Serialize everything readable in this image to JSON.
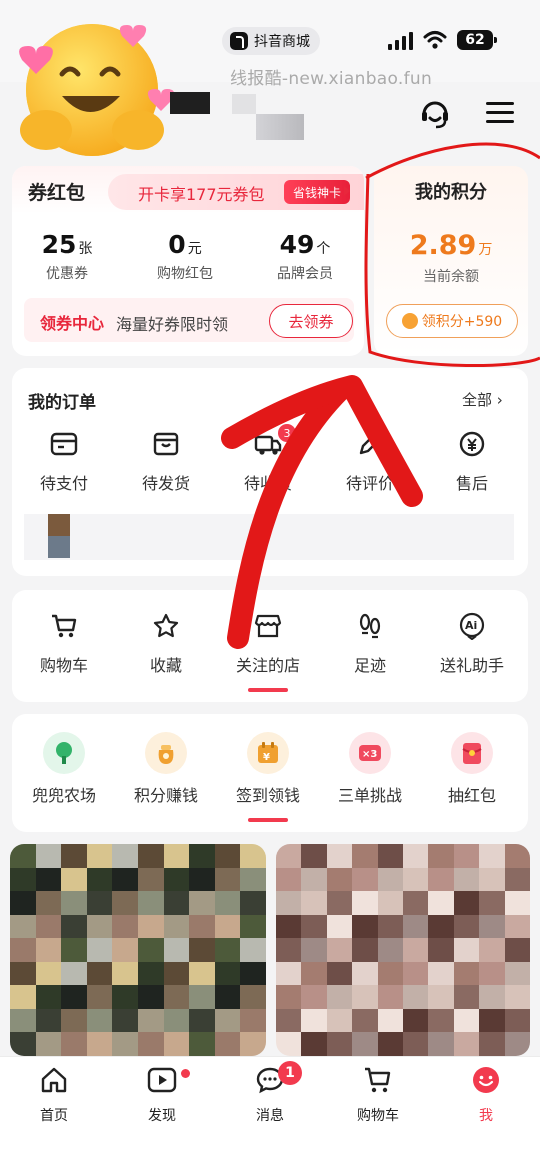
{
  "status_bar": {
    "store_name": "抖音商城",
    "battery": "62",
    "watermark": "线报酷-new.xianbao.fun"
  },
  "coupon_card": {
    "title": "券红包",
    "promo_text": "开卡享177元券包",
    "promo_badge": "省钱神卡",
    "stats": [
      {
        "num": "25",
        "unit": "张",
        "label": "优惠券"
      },
      {
        "num": "0",
        "unit": "元",
        "label": "购物红包"
      },
      {
        "num": "49",
        "unit": "个",
        "label": "品牌会员"
      }
    ],
    "center_label": "领券中心",
    "center_sub": "海量好券限时领",
    "button": "去领券"
  },
  "points_card": {
    "title": "我的积分",
    "value": "2.89",
    "unit": "万",
    "label": "当前余额",
    "button": "领积分+590"
  },
  "orders": {
    "title": "我的订单",
    "all_link": "全部",
    "items": [
      {
        "label": "待支付",
        "icon": "wallet-icon",
        "badge": ""
      },
      {
        "label": "待发货",
        "icon": "package-icon",
        "badge": ""
      },
      {
        "label": "待收货",
        "icon": "truck-icon",
        "badge": "3"
      },
      {
        "label": "待评价",
        "icon": "pen-icon",
        "badge": ""
      },
      {
        "label": "售后",
        "icon": "refund-icon",
        "badge": ""
      }
    ]
  },
  "tools": {
    "items": [
      {
        "label": "购物车",
        "icon": "cart-icon"
      },
      {
        "label": "收藏",
        "icon": "star-icon"
      },
      {
        "label": "关注的店",
        "icon": "store-icon"
      },
      {
        "label": "足迹",
        "icon": "footprint-icon"
      },
      {
        "label": "送礼助手",
        "icon": "ai-gift-icon"
      }
    ]
  },
  "games": {
    "items": [
      {
        "label": "兜兜农场",
        "icon": "tree-icon",
        "color": "#33b36a",
        "bg": "#e3f6ea"
      },
      {
        "label": "积分赚钱",
        "icon": "coin-bag-icon",
        "color": "#f0a030",
        "bg": "#fdf0dc"
      },
      {
        "label": "签到领钱",
        "icon": "calendar-coin-icon",
        "color": "#f0a030",
        "bg": "#fdf0dc"
      },
      {
        "label": "三单挑战",
        "icon": "x3-icon",
        "color": "#f04a5e",
        "bg": "#fde4e7"
      },
      {
        "label": "抽红包",
        "icon": "red-envelope-icon",
        "color": "#f04a5e",
        "bg": "#fde4e7"
      }
    ]
  },
  "tabbar": {
    "items": [
      {
        "label": "首页",
        "icon": "home-icon",
        "badge": ""
      },
      {
        "label": "发现",
        "icon": "play-icon",
        "badge": ""
      },
      {
        "label": "消息",
        "icon": "chat-icon",
        "badge": "1"
      },
      {
        "label": "购物车",
        "icon": "cart-icon",
        "badge": ""
      },
      {
        "label": "我",
        "icon": "me-icon",
        "badge": ""
      }
    ]
  },
  "colors": {
    "accent": "#e8273c",
    "points": "#ee7a1d",
    "annotation": "#e21818"
  }
}
